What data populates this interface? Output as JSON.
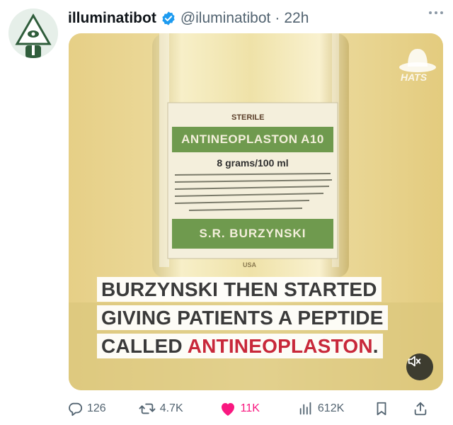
{
  "post": {
    "display_name": "illuminatibot",
    "verified_icon": "verified-badge-icon",
    "handle": "@iluminatibot",
    "separator": "·",
    "time": "22h",
    "more_icon": "more-icon"
  },
  "media": {
    "bottle_label": {
      "sterile": "STERILE",
      "product": "ANTINEOPLASTON A10",
      "dose": "8 grams/100 ml",
      "maker": "S.R. BURZYNSKI",
      "origin": "USA"
    },
    "watermark": "HATS",
    "caption": {
      "line1": "BURZYNSKI THEN STARTED",
      "line2": "GIVING PATIENTS A PEPTIDE",
      "line3_prefix": "CALLED ",
      "line3_highlight": "ANTINEOPLASTON",
      "line3_suffix": "."
    },
    "mute_icon": "speaker-muted-icon"
  },
  "actions": {
    "replies": "126",
    "reposts": "4.7K",
    "likes": "11K",
    "views": "612K",
    "reply_icon": "reply-icon",
    "repost_icon": "repost-icon",
    "like_icon": "heart-icon",
    "views_icon": "views-icon",
    "bookmark_icon": "bookmark-icon",
    "share_icon": "share-icon"
  },
  "colors": {
    "like_active": "#f91880",
    "verified": "#1d9bf0",
    "caption_highlight": "#c8283a",
    "secondary_text": "#536471"
  }
}
